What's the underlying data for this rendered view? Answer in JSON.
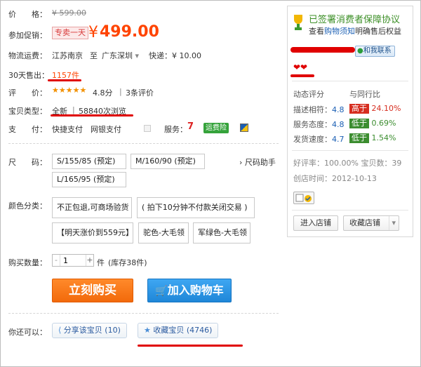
{
  "price": {
    "label": "价　　格：",
    "original": "¥ 599.00"
  },
  "promo": {
    "label": "参加促销：",
    "tag": "专卖一天",
    "currency": "¥",
    "amount": "499.00"
  },
  "shipping": {
    "label": "物流运费：",
    "from": "江苏南京",
    "separator": "至",
    "to": "广东深圳",
    "method": "快递：¥ 10.00"
  },
  "sales": {
    "label": "30天售出：",
    "count": "1157件"
  },
  "rating": {
    "label": "评　　价：",
    "stars": "★★★★★",
    "score": "4.8分",
    "reviews": "3条评价"
  },
  "condition": {
    "label": "宝贝类型：",
    "type": "全新",
    "views": "58840次浏览"
  },
  "payment": {
    "label": "支　　付：",
    "methods": "快捷支付　网银支付",
    "service_label": "服务：",
    "service_badge": "运费险"
  },
  "size": {
    "label": "尺　　码：",
    "options": [
      "S/155/85 (预定)",
      "M/160/90 (预定)",
      "L/165/95 (预定)"
    ],
    "help": "尺码助手"
  },
  "color": {
    "label": "颜色分类：",
    "options": [
      "不正包退,可商场验货",
      "( 拍下10分钟不付款关闭交易 )",
      "【明天涨价到559元】",
      "驼色-大毛领",
      "军绿色-大毛领"
    ]
  },
  "quantity": {
    "label": "购买数量：",
    "value": "1",
    "minus": "-",
    "plus": "+",
    "unit": "件",
    "stock": "(库存38件)"
  },
  "actions": {
    "buy": "立刻购买",
    "cart": "加入购物车"
  },
  "share": {
    "label": "你还可以：",
    "share_btn": "分享该宝贝 (10)",
    "fav_btn": "收藏宝贝 (4746)"
  },
  "seller": {
    "guarantee_title": "已签署消费者保障协议",
    "guarantee_sub_prefix": "查看",
    "guarantee_link": "购物须知",
    "guarantee_sub_suffix": "明确售后权益",
    "contact": "和我联系",
    "hearts": "❤❤",
    "dynamic_label": "动态评分",
    "compare_label": "与同行比",
    "ratings": [
      {
        "name": "描述相符：",
        "score": "4.8",
        "badge": "高于",
        "pct": "24.10%",
        "dir": "up"
      },
      {
        "name": "服务态度：",
        "score": "4.8",
        "badge": "低于",
        "pct": "0.69%",
        "dir": "down"
      },
      {
        "name": "发货速度：",
        "score": "4.7",
        "badge": "低于",
        "pct": "1.54%",
        "dir": "down"
      }
    ],
    "good_rate": "好评率：100.00% 宝贝数：39",
    "created": "创店时间：2012-10-13",
    "enter_btn": "进入店铺",
    "fav_btn": "收藏店铺",
    "fav_caret": "▾"
  },
  "colors": {
    "accent_orange": "#f40",
    "highlight_red": "#e00000",
    "buy": "#f26a0b",
    "cart": "#1f87d8"
  }
}
